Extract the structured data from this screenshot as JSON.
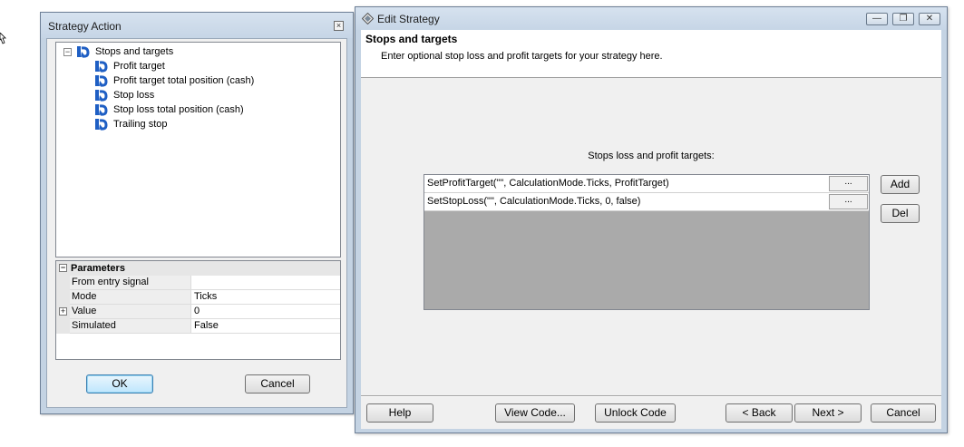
{
  "strategy_action": {
    "title": "Strategy Action",
    "close_glyph": "×",
    "tree": {
      "root": {
        "label": "Stops and targets",
        "expander": "−",
        "icon": "action-arrow-icon"
      },
      "children": [
        {
          "label": "Profit target",
          "icon": "action-arrow-icon"
        },
        {
          "label": "Profit target total position (cash)",
          "icon": "action-arrow-icon"
        },
        {
          "label": "Stop loss",
          "icon": "action-arrow-icon"
        },
        {
          "label": "Stop loss total position (cash)",
          "icon": "action-arrow-icon"
        },
        {
          "label": "Trailing stop",
          "icon": "action-arrow-icon"
        }
      ]
    },
    "parameters": {
      "header": "Parameters",
      "collapse_glyph": "−",
      "expand_glyph": "+",
      "rows": [
        {
          "name": "From entry signal",
          "value": ""
        },
        {
          "name": "Mode",
          "value": "Ticks"
        },
        {
          "name": "Value",
          "value": "0"
        },
        {
          "name": "Simulated",
          "value": "False"
        }
      ]
    },
    "ok_label": "OK",
    "cancel_label": "Cancel"
  },
  "edit_strategy": {
    "title": "Edit Strategy",
    "caption_buttons": {
      "minimize": "—",
      "restore": "❐",
      "close": "✕"
    },
    "heading": "Stops and targets",
    "subheading": "Enter optional stop loss and profit targets for your strategy here.",
    "list_caption": "Stops loss and profit targets:",
    "list_rows": [
      {
        "code": "SetProfitTarget(\"\", CalculationMode.Ticks, ProfitTarget)",
        "button": "..."
      },
      {
        "code": "SetStopLoss(\"\", CalculationMode.Ticks, 0, false)",
        "button": "..."
      }
    ],
    "add_label": "Add",
    "del_label": "Del",
    "footer_buttons": {
      "help": "Help",
      "view_code": "View Code...",
      "unlock_code": "Unlock Code",
      "back": "< Back",
      "next": "Next >",
      "cancel": "Cancel"
    }
  },
  "colors": {
    "window_frame": "#c4d3e3",
    "client_background": "#f0f0f0",
    "list_background": "#aaaaaa",
    "icon_blue": "#1f5fc4"
  }
}
